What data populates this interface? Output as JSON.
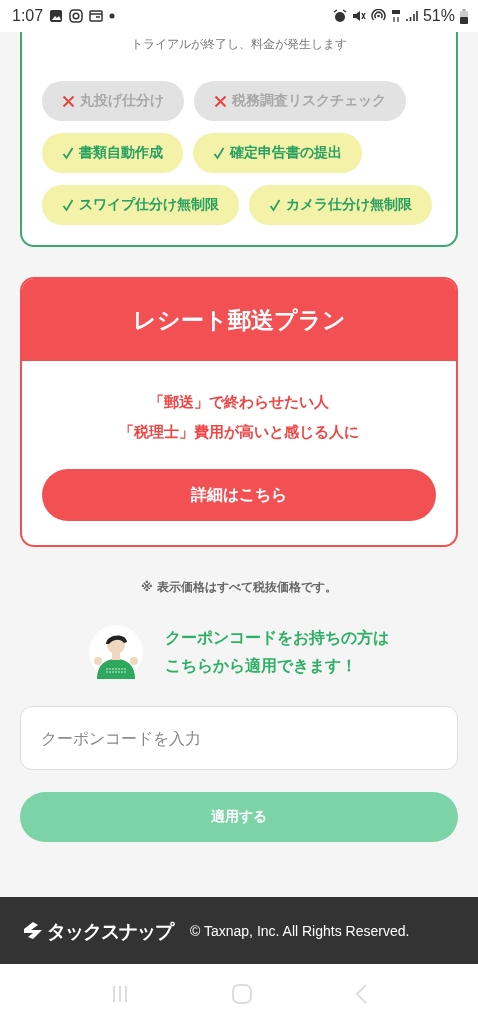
{
  "status_bar": {
    "time": "1:07",
    "battery": "51%"
  },
  "trial_card": {
    "note": "トライアルが終了し、料金が発生します",
    "features": [
      {
        "label": "丸投げ仕分け",
        "included": false
      },
      {
        "label": "税務調査リスクチェック",
        "included": false
      },
      {
        "label": "書類自動作成",
        "included": true
      },
      {
        "label": "確定申告書の提出",
        "included": true
      },
      {
        "label": "スワイプ仕分け無制限",
        "included": true
      },
      {
        "label": "カメラ仕分け無制限",
        "included": true
      }
    ]
  },
  "mail_plan": {
    "title": "レシート郵送プラン",
    "lines": [
      "「郵送」で終わらせたい人",
      "「税理士」費用が高いと感じる人に"
    ],
    "button": "詳細はこちら"
  },
  "tax_note": "※ 表示価格はすべて税抜価格です。",
  "coupon": {
    "message_lines": [
      "クーポンコードをお持ちの方は",
      "こちらから適用できます！"
    ],
    "placeholder": "クーポンコードを入力",
    "button": "適用する",
    "button_disabled": true
  },
  "footer": {
    "logo_text": "タックスナップ",
    "copyright": "© Taxnap, Inc. All Rights Reserved."
  }
}
